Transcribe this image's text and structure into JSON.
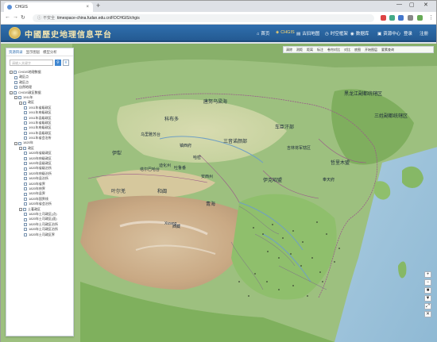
{
  "browser": {
    "tab_title": "CHGIS",
    "tab_close": "×",
    "new_tab": "+",
    "window_controls": [
      "—",
      "▢",
      "✕"
    ],
    "security_label": "不安全",
    "url": "timespace-china.fudan.edu.cn/FDCHGIS/chgis"
  },
  "site": {
    "logo_text": "中國歷史地理信息平台",
    "nav": [
      {
        "label": "首页",
        "icon": "home-icon",
        "glyph": "⌂"
      },
      {
        "label": "CHGIS",
        "icon": "layers-icon",
        "glyph": "◈"
      },
      {
        "label": "古旧地图",
        "icon": "map-icon",
        "glyph": "▤"
      },
      {
        "label": "时空框架",
        "icon": "clock-icon",
        "glyph": "◷"
      },
      {
        "label": "数据库",
        "icon": "database-icon",
        "glyph": "◉"
      },
      {
        "label": "资源中心",
        "icon": "user-icon",
        "glyph": "▣"
      },
      {
        "label": "登录",
        "icon": "",
        "glyph": ""
      },
      {
        "label": "注册",
        "icon": "",
        "glyph": ""
      }
    ],
    "active_nav": "CHGIS"
  },
  "panel": {
    "tabs": [
      "资源目录",
      "显示图层",
      "模型分析"
    ],
    "search_placeholder": "请输入关键字",
    "search_glyph": "⚲",
    "filter_glyph": "≡",
    "tree": [
      {
        "depth": 0,
        "toggle": "−",
        "label": "CHGIS地理数据"
      },
      {
        "depth": 1,
        "toggle": "",
        "label": "政区点"
      },
      {
        "depth": 1,
        "toggle": "",
        "label": "政区点"
      },
      {
        "depth": 1,
        "toggle": "",
        "label": "自然地理"
      },
      {
        "depth": 0,
        "toggle": "−",
        "label": "CHGIS政区数据"
      },
      {
        "depth": 1,
        "toggle": "−",
        "label": "1911年"
      },
      {
        "depth": 2,
        "toggle": "−",
        "label": "政区"
      },
      {
        "depth": 3,
        "toggle": "",
        "label": "1911年省级政区"
      },
      {
        "depth": 3,
        "toggle": "",
        "label": "1911年府级政区"
      },
      {
        "depth": 3,
        "toggle": "",
        "label": "1911年县级政区"
      },
      {
        "depth": 3,
        "toggle": "",
        "label": "1911年省级政区"
      },
      {
        "depth": 3,
        "toggle": "",
        "label": "1911年府级政区"
      },
      {
        "depth": 3,
        "toggle": "",
        "label": "1911年县级政区"
      },
      {
        "depth": 3,
        "toggle": "",
        "label": "1911年省会治所"
      },
      {
        "depth": 1,
        "toggle": "−",
        "label": "1820年"
      },
      {
        "depth": 2,
        "toggle": "−",
        "label": "政区"
      },
      {
        "depth": 3,
        "toggle": "",
        "label": "1820年省级政区"
      },
      {
        "depth": 3,
        "toggle": "",
        "label": "1820年府级政区"
      },
      {
        "depth": 3,
        "toggle": "",
        "label": "1820年县级政区"
      },
      {
        "depth": 3,
        "toggle": "",
        "label": "1820年省级治所"
      },
      {
        "depth": 3,
        "toggle": "",
        "label": "1820年府级治所"
      },
      {
        "depth": 3,
        "toggle": "",
        "label": "1820年县治所"
      },
      {
        "depth": 3,
        "toggle": "",
        "label": "1820年省界"
      },
      {
        "depth": 3,
        "toggle": "",
        "label": "1820年府界"
      },
      {
        "depth": 3,
        "toggle": "",
        "label": "1820年县界"
      },
      {
        "depth": 3,
        "toggle": "",
        "label": "1820年国界线"
      },
      {
        "depth": 3,
        "toggle": "",
        "label": "1820年省会治所"
      },
      {
        "depth": 2,
        "toggle": "−",
        "label": "土著政区"
      },
      {
        "depth": 3,
        "toggle": "",
        "label": "1820年土司政区(点)"
      },
      {
        "depth": 3,
        "toggle": "",
        "label": "1820年土司政区(面)"
      },
      {
        "depth": 3,
        "toggle": "",
        "label": "1820年土司政区治所"
      },
      {
        "depth": 3,
        "toggle": "",
        "label": "1820年土司政区治所"
      },
      {
        "depth": 3,
        "toggle": "",
        "label": "1820年土司政区界"
      }
    ]
  },
  "maptools": [
    "清除",
    "测距",
    "距离",
    "标注",
    "卷帘对比",
    "对比",
    "底图",
    "开始图层",
    "要素查询"
  ],
  "zoom_controls": [
    "+",
    "−",
    "■",
    "▼",
    "⤢",
    "✕"
  ],
  "map_labels": [
    {
      "text": "唐努乌梁海",
      "big": true
    },
    {
      "text": "黑龙江副都统辖区",
      "big": true
    },
    {
      "text": "三姓副都统辖区",
      "big": true
    },
    {
      "text": "科布多",
      "big": true
    },
    {
      "text": "车臣汗部",
      "big": true
    },
    {
      "text": "乌里雅苏台",
      "big": false
    },
    {
      "text": "三音诺颜部",
      "big": true
    },
    {
      "text": "吉林将军辖区",
      "big": false
    },
    {
      "text": "伊犁",
      "big": true
    },
    {
      "text": "哲里木盟",
      "big": true
    },
    {
      "text": "塔尔巴哈台",
      "big": false
    },
    {
      "text": "镇西府",
      "big": false
    },
    {
      "text": "哈密",
      "big": false
    },
    {
      "text": "迪化州",
      "big": false
    },
    {
      "text": "吐鲁番",
      "big": false
    },
    {
      "text": "奉天府",
      "big": false
    },
    {
      "text": "叶尔羌",
      "big": true
    },
    {
      "text": "和阗",
      "big": true
    },
    {
      "text": "安西州",
      "big": false
    },
    {
      "text": "伊克昭盟",
      "big": true
    },
    {
      "text": "青海",
      "big": true
    },
    {
      "text": "西藏",
      "big": false
    },
    {
      "text": "Xizang",
      "big": false
    }
  ]
}
